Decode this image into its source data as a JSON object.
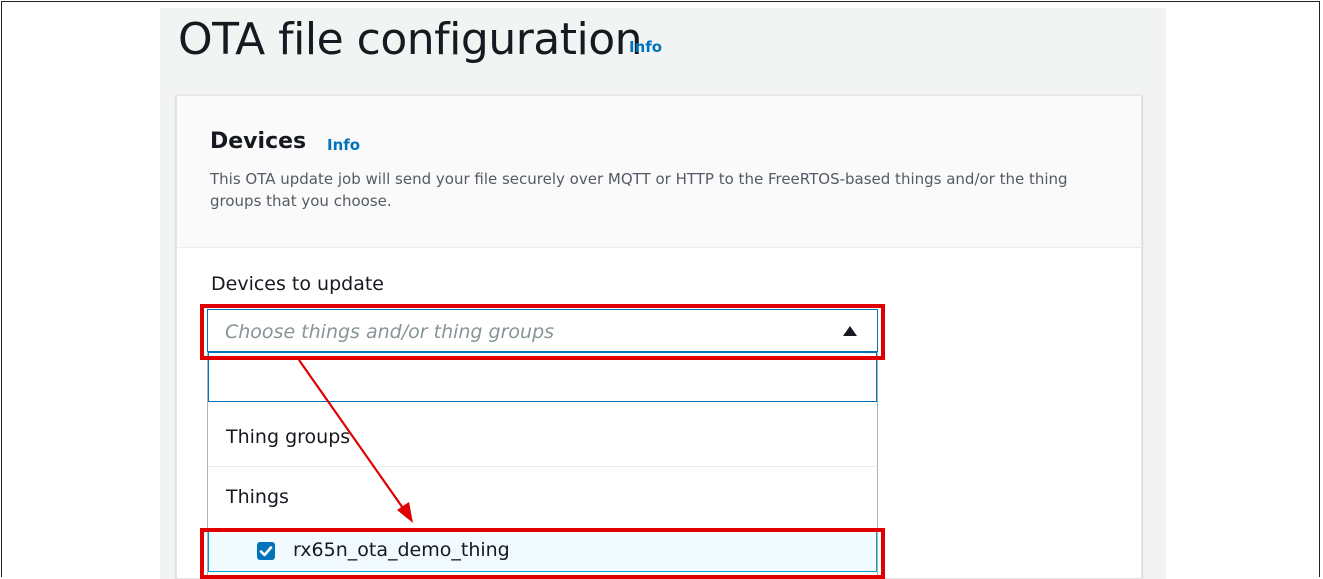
{
  "page": {
    "title": "OTA file configuration",
    "title_info": "Info"
  },
  "devices_panel": {
    "title": "Devices",
    "info": "Info",
    "description": "This OTA update job will send your file securely over MQTT or HTTP to the FreeRTOS-based things and/or the thing groups that you choose."
  },
  "devices_to_update": {
    "label": "Devices to update",
    "placeholder": "Choose things and/or thing groups",
    "search_value": "",
    "groups": [
      {
        "label": "Thing groups"
      },
      {
        "label": "Things"
      }
    ],
    "options": [
      {
        "label": "rx65n_ota_demo_thing",
        "checked": true
      }
    ]
  },
  "colors": {
    "link": "#0073bb",
    "highlight": "#e00000",
    "focus": "#0073bb",
    "background": "#f2f3f3"
  },
  "icons": {
    "search": "search-icon",
    "caret": "caret-up-icon",
    "check": "checkmark-icon"
  }
}
